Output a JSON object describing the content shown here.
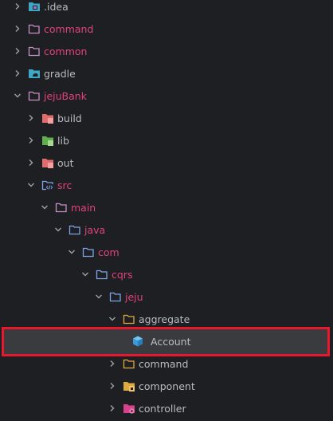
{
  "colors": {
    "excluded_text": "#e0437a",
    "normal_text": "#b8bbbf",
    "selection_border": "#e8192c",
    "selection_bg": "#3a3b3f",
    "folder_pink": "#c490c6",
    "folder_blue": "#7ea3e6",
    "folder_orange": "#e0a93d"
  },
  "tree": [
    {
      "label": ".idea",
      "expanded": false,
      "icon": "idea-folder-icon"
    },
    {
      "label": "command",
      "expanded": false,
      "icon": "folder-icon"
    },
    {
      "label": "common",
      "expanded": false,
      "icon": "folder-icon"
    },
    {
      "label": "gradle",
      "expanded": false,
      "icon": "gradle-folder-icon"
    },
    {
      "label": "jejuBank",
      "expanded": true,
      "icon": "folder-icon"
    },
    {
      "label": "build",
      "expanded": false,
      "icon": "build-folder-icon"
    },
    {
      "label": "lib",
      "expanded": false,
      "icon": "lib-folder-icon"
    },
    {
      "label": "out",
      "expanded": false,
      "icon": "out-folder-icon"
    },
    {
      "label": "src",
      "expanded": true,
      "icon": "src-folder-icon"
    },
    {
      "label": "main",
      "expanded": true,
      "icon": "folder-icon"
    },
    {
      "label": "java",
      "expanded": true,
      "icon": "source-root-folder-icon"
    },
    {
      "label": "com",
      "expanded": true,
      "icon": "package-folder-icon"
    },
    {
      "label": "cqrs",
      "expanded": true,
      "icon": "package-folder-icon"
    },
    {
      "label": "jeju",
      "expanded": true,
      "icon": "package-folder-icon"
    },
    {
      "label": "aggregate",
      "expanded": true,
      "icon": "package-folder-icon"
    },
    {
      "label": "Account",
      "expanded": null,
      "icon": "java-class-cube-icon",
      "selected": true
    },
    {
      "label": "command",
      "expanded": false,
      "icon": "package-folder-icon"
    },
    {
      "label": "component",
      "expanded": false,
      "icon": "component-folder-icon"
    },
    {
      "label": "controller",
      "expanded": false,
      "icon": "controller-folder-icon"
    }
  ]
}
